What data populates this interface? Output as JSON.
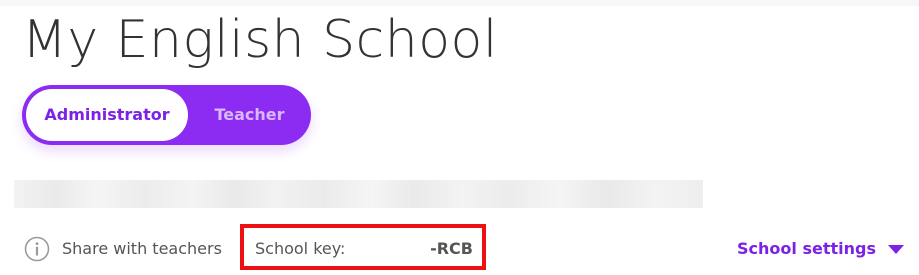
{
  "page_title": "My English School",
  "role_toggle": {
    "options": [
      {
        "label": "Administrator",
        "selected": true
      },
      {
        "label": "Teacher",
        "selected": false
      }
    ]
  },
  "share": {
    "icon": "info-icon",
    "label": "Share with teachers"
  },
  "school_key": {
    "label": "School key:",
    "value": "-RCB"
  },
  "school_settings": {
    "label": "School settings",
    "icon": "caret-down-icon"
  },
  "colors": {
    "accent": "#7b22e6",
    "toggle_background": "#8c2cf2",
    "highlight_border": "#ee1111",
    "text": "#555555"
  }
}
